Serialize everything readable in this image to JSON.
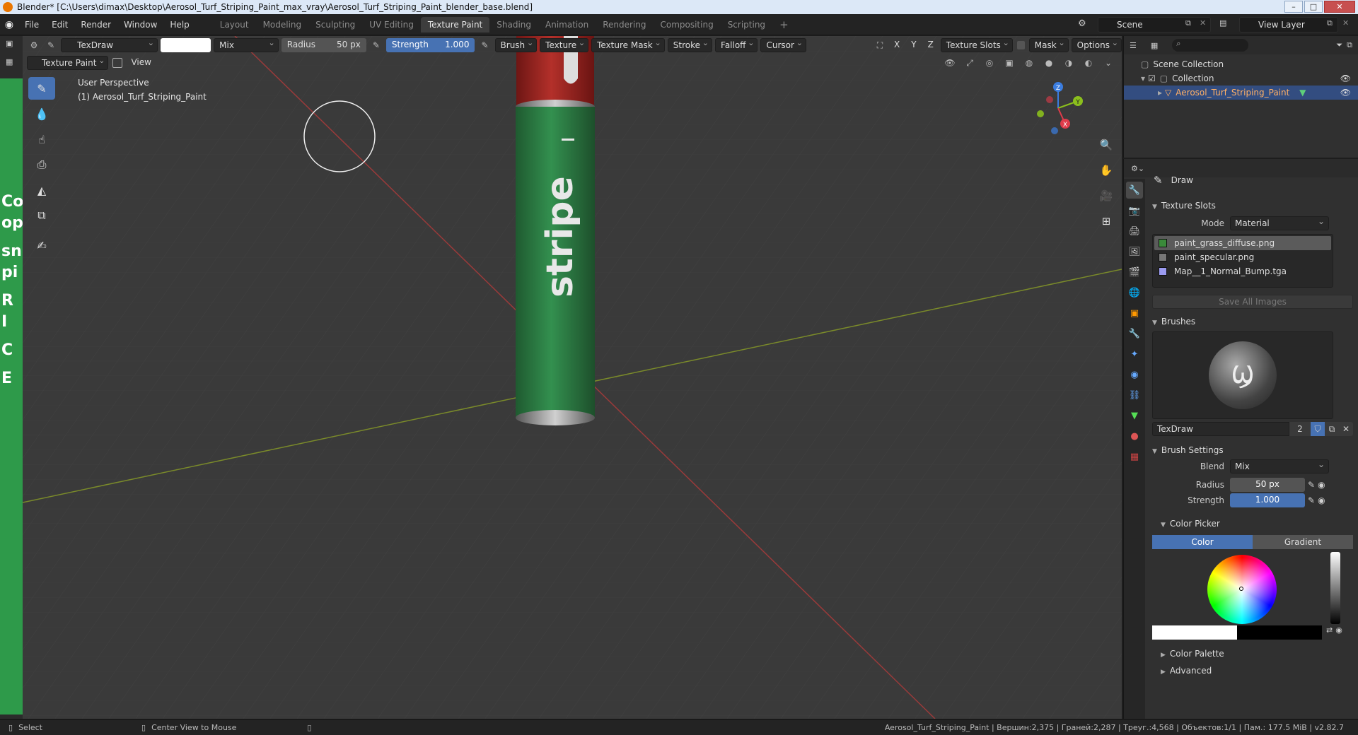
{
  "window": {
    "title": "Blender* [C:\\Users\\dimax\\Desktop\\Aerosol_Turf_Striping_Paint_max_vray\\Aerosol_Turf_Striping_Paint_blender_base.blend]",
    "controls": [
      "–",
      "□",
      "✕"
    ]
  },
  "menu": [
    "File",
    "Edit",
    "Render",
    "Window",
    "Help"
  ],
  "workspaces": [
    "Layout",
    "Modeling",
    "Sculpting",
    "UV Editing",
    "Texture Paint",
    "Shading",
    "Animation",
    "Rendering",
    "Compositing",
    "Scripting"
  ],
  "active_workspace": "Texture Paint",
  "add_workspace": "+",
  "scene": "Scene",
  "view_layer": "View Layer",
  "tool_header": {
    "brush_name": "TexDraw",
    "blend": "Mix",
    "radius_label": "Radius",
    "radius_value": "50 px",
    "strength_label": "Strength",
    "strength_value": "1.000",
    "menus": [
      "Brush",
      "Texture",
      "Texture Mask",
      "Stroke",
      "Falloff",
      "Cursor"
    ],
    "axes": [
      "X",
      "Y",
      "Z"
    ],
    "texture_slots": "Texture Slots",
    "mask": "Mask",
    "options": "Options"
  },
  "viewport_header": {
    "mode": "Texture Paint",
    "view": "View"
  },
  "overlay": {
    "perspective": "User Perspective",
    "object": "(1) Aerosol_Turf_Striping_Paint"
  },
  "can_label": "stripe",
  "left_texture_text": [
    "Co",
    "op",
    "sn",
    "pi",
    "R I",
    "C",
    "E"
  ],
  "gizmo_axes": [
    "Z",
    "Y",
    "X"
  ],
  "outliner": {
    "scene_collection": "Scene Collection",
    "collection": "Collection",
    "object": "Aerosol_Turf_Striping_Paint"
  },
  "properties": {
    "tool_name": "Draw",
    "texture_slots_header": "Texture Slots",
    "mode_label": "Mode",
    "mode_value": "Material",
    "slots": [
      "paint_grass_diffuse.png",
      "paint_specular.png",
      "Map__1_Normal_Bump.tga"
    ],
    "slot_colors": [
      "#3a8a3a",
      "#777777",
      "#9b9bf0"
    ],
    "save_all": "Save All Images",
    "brushes_header": "Brushes",
    "brush_name": "TexDraw",
    "brush_users": "2",
    "brush_settings_header": "Brush Settings",
    "blend_label": "Blend",
    "blend_value": "Mix",
    "radius_label": "Radius",
    "radius_value": "50 px",
    "strength_label": "Strength",
    "strength_value": "1.000",
    "color_picker_header": "Color Picker",
    "color_tab": "Color",
    "gradient_tab": "Gradient",
    "color_palette": "Color Palette",
    "advanced": "Advanced"
  },
  "status": {
    "select": "Select",
    "center": "Center View to Mouse",
    "stats": "Aerosol_Turf_Striping_Paint | Вершин:2,375 | Граней:2,287 | Треуг.:4,568 | Объектов:1/1 | Пам.: 177.5 MiB | v2.82.7"
  },
  "colors": {
    "accent": "#4772b3",
    "can_green": "#2e7a45",
    "can_red": "#a8221f"
  }
}
